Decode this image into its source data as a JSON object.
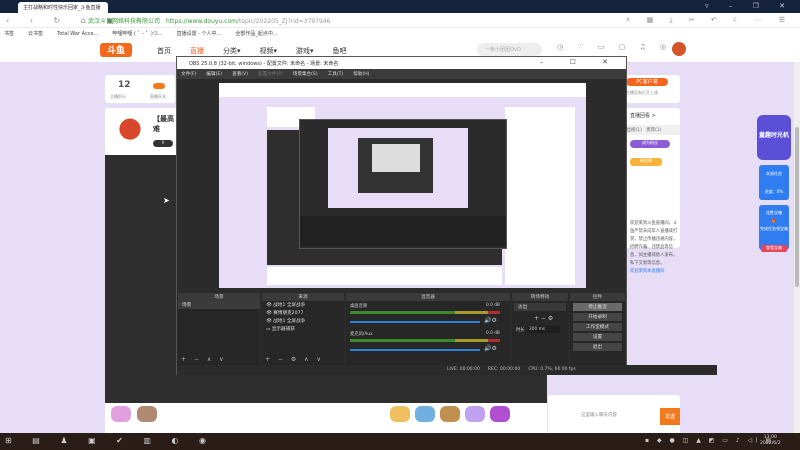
{
  "browser": {
    "tab_title": "主打战略和时性快乐回家_斗鱼直播",
    "url_org": "武汉斗鱼网络科技有限公司",
    "url_domain": "https://www.douyu.com",
    "url_path": "/topic/202205_ZJ?rid=3797946",
    "bookmarks": [
      "书签",
      "云书签",
      "Total War Acce...",
      "哔哩哔哩 ( ゜- ゜)つ...",
      "直播设置 - 个人中...",
      "全部作品_起点中..."
    ]
  },
  "douyu": {
    "nav": [
      "首页",
      "直播",
      "分类▾",
      "视频▾",
      "游戏▾",
      "鱼吧"
    ],
    "active_nav": "直播",
    "search_placeholder": "一条小团团OvO",
    "stat_value": "12",
    "stat_label": "主播积分",
    "toggle_label": "直播开关",
    "stream_title": "【最高难",
    "pc_client": "PC客户端",
    "pc_note": "主播没有打开上线",
    "replay": "直播回看 >",
    "rank_tabs": [
      "粉丝榜(1)",
      "贵宾(1)"
    ],
    "become_fan": "成为粉丝",
    "fan_badge": "粉丝牌",
    "chat_notice": "欢迎来到斗鱼直播间，斗鱼严禁未成年人直播或打赏，禁止传播违规内容，招聘诈骗、违禁品等信息，如主播或他人发布，私下交易等信息。",
    "welcome": "欢迎来到本直播间",
    "chat_placeholder": "这里输入聊天内容",
    "send": "发送",
    "float": {
      "title": "童趣时光机",
      "b1": "本周任务",
      "b2": "进度：0%",
      "c1": "连胜宝箱",
      "c2": "完成任务领宝箱",
      "c3": "查看宝箱"
    },
    "colors": {
      "brand": "#f26b1d",
      "bg": "#e7ddf6"
    }
  },
  "obs": {
    "title": "OBS 25.0.8 (32-bit, windows) - 配置文件: 未命名 - 场景: 未命名",
    "menu": [
      "文件(F)",
      "编辑(E)",
      "查看(V)",
      "配置文件(P)",
      "场景集合(S)",
      "工具(T)",
      "帮助(H)"
    ],
    "docks": {
      "scenes": "场景",
      "sources": "来源",
      "mixer": "混音器",
      "transitions": "转场特效",
      "controls": "控件"
    },
    "scenes": [
      "场景"
    ],
    "sources": [
      "战地1 全屏战争",
      "赛博朋克2077",
      "战地1 全屏战争",
      "显示器捕获"
    ],
    "mixer": [
      {
        "name": "桌面音频",
        "db": "0.0 dB"
      },
      {
        "name": "麦克风/Aux",
        "db": "0.0 dB"
      }
    ],
    "transition": "淡出",
    "duration_label": "时长",
    "duration": "300 ms",
    "controls": [
      "停止推流",
      "开始录制",
      "工作室模式",
      "设置",
      "退出"
    ],
    "status": [
      "LIVE: 00:00:00",
      "REC: 00:00:00",
      "CPU: 0.7%, 60.00 fps"
    ]
  },
  "taskbar": {
    "time": "13:00",
    "date": "2022/6/2"
  }
}
